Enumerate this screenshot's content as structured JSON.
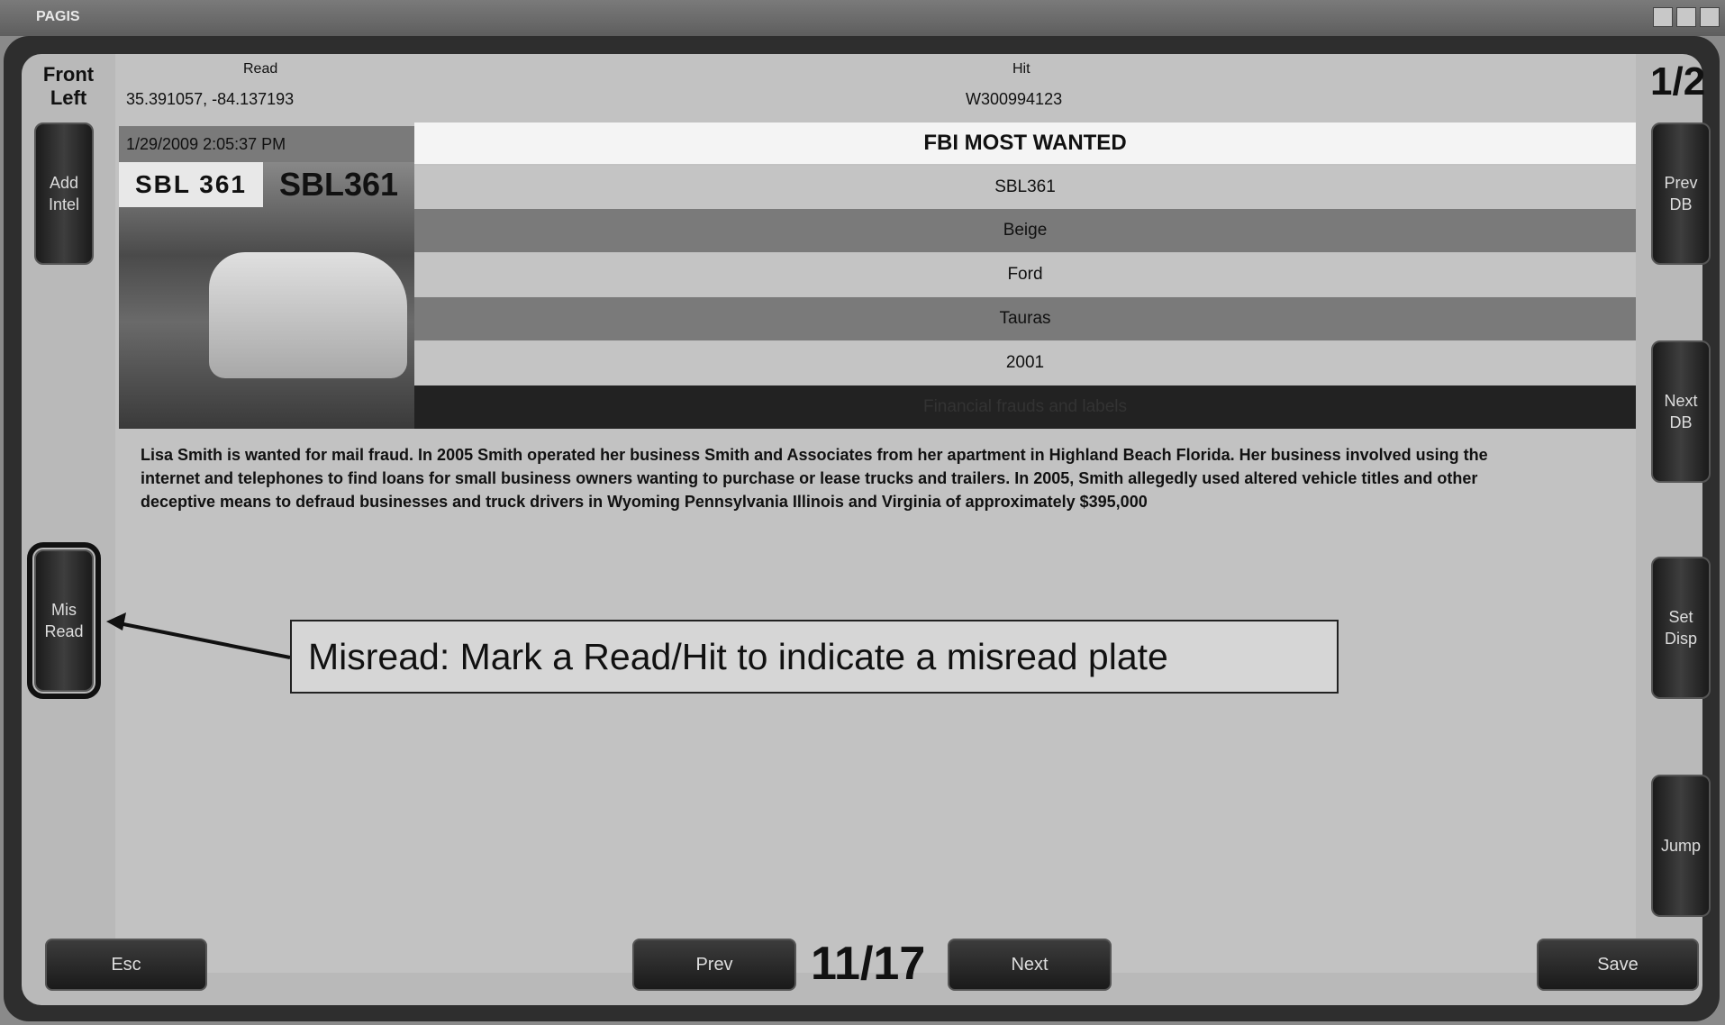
{
  "window": {
    "title": "PAGIS"
  },
  "header": {
    "camera": "Front\nLeft",
    "read_label": "Read",
    "coords": "35.391057, -84.137193",
    "hit_label": "Hit",
    "hit_id": "W300994123",
    "page": "1/2",
    "timestamp": "1/29/2009 2:05:37 PM"
  },
  "hit": {
    "alert_title": "FBI MOST WANTED",
    "plate_text": "SBL361",
    "plate_crop": "SBL 361",
    "fields": [
      "SBL361",
      "Beige",
      "Ford",
      "Tauras",
      "2001",
      "Financial frauds and labels"
    ]
  },
  "description": "Lisa Smith is wanted for mail fraud. In 2005 Smith operated her business Smith and Associates from her apartment in Highland Beach Florida. Her business involved using the internet and telephones to find loans for small business owners wanting to purchase or lease trucks and trailers. In 2005, Smith allegedly used altered vehicle titles and other deceptive means to defraud businesses and truck drivers in Wyoming Pennsylvania Illinois and Virginia of approximately $395,000",
  "left_buttons": {
    "add_intel": "Add\nIntel",
    "misread": "Mis\nRead"
  },
  "right_buttons": {
    "prev_db": "Prev\nDB",
    "next_db": "Next\nDB",
    "set_disp": "Set\nDisp",
    "jump": "Jump"
  },
  "callout": "Misread: Mark a Read/Hit to indicate a misread plate",
  "footer": {
    "esc": "Esc",
    "prev": "Prev",
    "counter": "11/17",
    "next": "Next",
    "save": "Save"
  },
  "colors": {
    "frame": "#2e2e2e",
    "panel": "#c2c2c2",
    "row_dark": "#7a7a7a",
    "row_light": "#c4c4c4",
    "row_black": "#222222"
  }
}
